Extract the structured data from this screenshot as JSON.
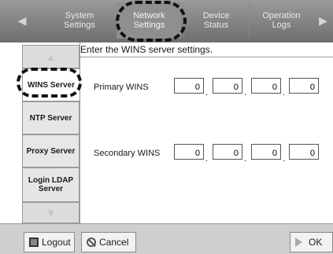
{
  "top_tabs": [
    {
      "label": "System\nSettings"
    },
    {
      "label": "Network\nSettings",
      "active": true
    },
    {
      "label": "Device\nStatus"
    },
    {
      "label": "Operation\nLogs"
    }
  ],
  "nav": {
    "prev_icon": "triangle-left-icon",
    "next_icon": "triangle-right-icon"
  },
  "sidebar": {
    "scroll_up_icon": "triangle-up-icon",
    "scroll_down_icon": "triangle-down-icon",
    "items": [
      {
        "label": "WINS Server",
        "active": true
      },
      {
        "label": "NTP Server"
      },
      {
        "label": "Proxy Server"
      },
      {
        "label": "Login LDAP Server"
      }
    ]
  },
  "main": {
    "instruction": "Enter the WINS server settings.",
    "primary": {
      "label": "Primary WINS",
      "octets": [
        "0",
        "0",
        "0",
        "0"
      ]
    },
    "secondary": {
      "label": "Secondary WINS",
      "octets": [
        "0",
        "0",
        "0",
        "0"
      ]
    }
  },
  "bottom": {
    "logout_label": "Logout",
    "cancel_label": "Cancel",
    "ok_label": "OK"
  }
}
